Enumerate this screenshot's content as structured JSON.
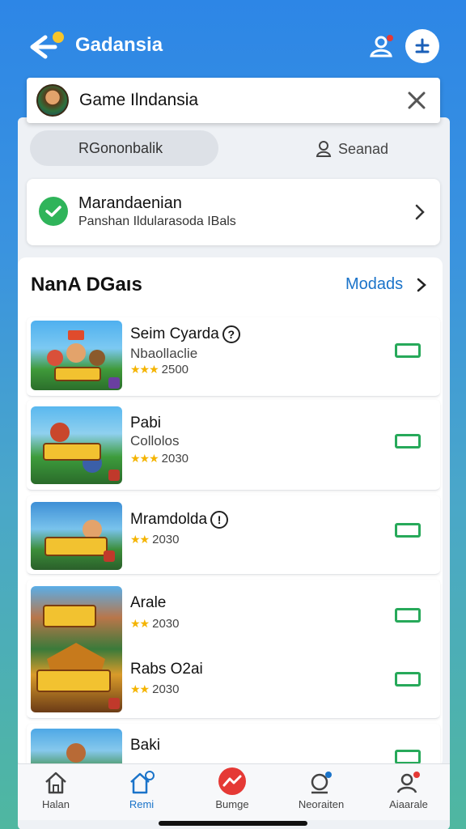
{
  "header": {
    "title": "Gadansia"
  },
  "search": {
    "value": "Game Ilndansia"
  },
  "segments": {
    "left": "RGononbalik",
    "right": "Seanad"
  },
  "status": {
    "title": "Marandaenian",
    "subtitle": "Panshan Ildularasoda IBals"
  },
  "section": {
    "title": "NanA DGaıs",
    "more": "Modads"
  },
  "games": [
    {
      "title": "Seim Cyarda",
      "subtitle": "Nbaollaclie",
      "rating": "2500",
      "info": true
    },
    {
      "title": "Pabi",
      "subtitle": "Collolos",
      "rating": "2030",
      "info": false
    },
    {
      "title": "Mramdolda",
      "subtitle": "",
      "rating": "2030",
      "info": true
    },
    {
      "title": "Arale",
      "subtitle": "",
      "rating": "2030",
      "info": false
    },
    {
      "title": "Rabs O2ai",
      "subtitle": "",
      "rating": "2030",
      "info": false
    },
    {
      "title": "Baki",
      "subtitle": "",
      "rating": "",
      "info": false
    }
  ],
  "nav": [
    {
      "label": "Halan",
      "icon": "home-icon"
    },
    {
      "label": "Remi",
      "icon": "store-icon"
    },
    {
      "label": "Bumge",
      "icon": "trending-icon"
    },
    {
      "label": "Neoraiten",
      "icon": "notifications-icon"
    },
    {
      "label": "Aiaarale",
      "icon": "account-icon"
    }
  ],
  "colors": {
    "accent": "#1a73c9",
    "toggle": "#27a95a",
    "bg": "#3a93df",
    "badge": "#e53935"
  }
}
